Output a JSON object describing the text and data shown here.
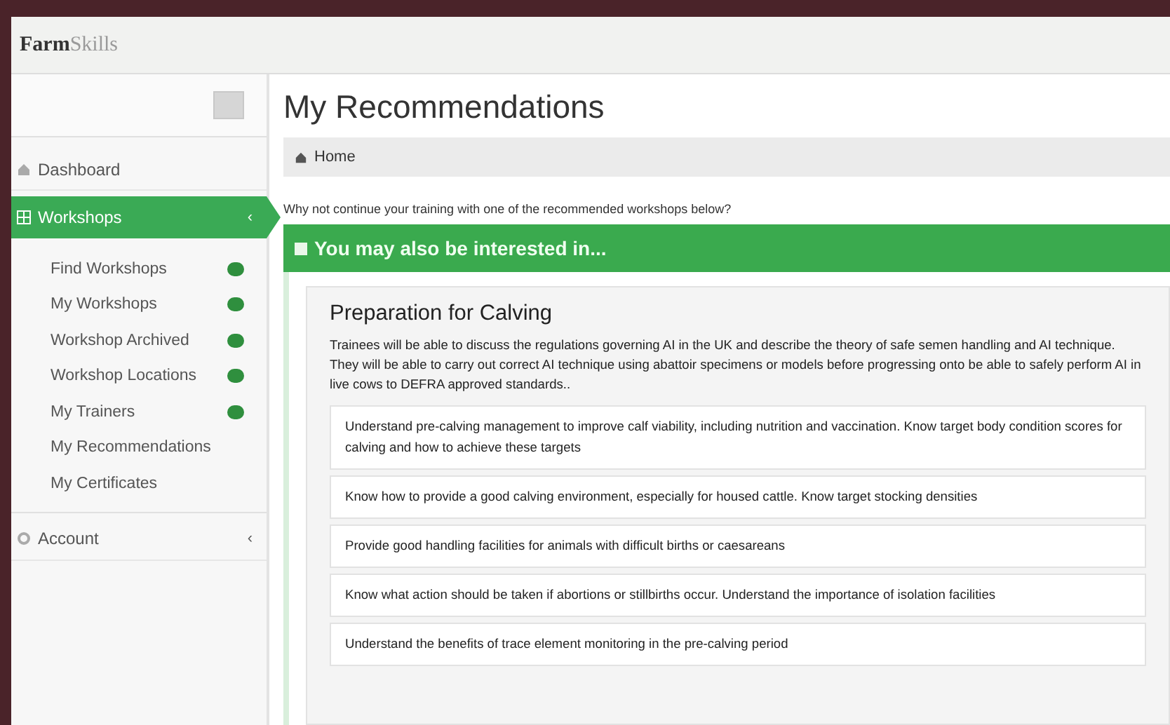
{
  "header": {
    "logo_dark": "Farm",
    "logo_light": "Skills"
  },
  "sidebar": {
    "items": [
      {
        "label": "Dashboard",
        "selected": false
      },
      {
        "label": "Workshops",
        "toggle": "‹",
        "selected": true,
        "children": [
          {
            "label": "Find Workshops",
            "badge": true
          },
          {
            "label": "My Workshops",
            "badge": true
          },
          {
            "label": "Workshop Archived",
            "badge": true
          },
          {
            "label": "Workshop Locations",
            "badge": true
          },
          {
            "label": "My Trainers",
            "badge": true
          },
          {
            "label": "My Recommendations",
            "badge": false
          },
          {
            "label": "My Certificates",
            "badge": false
          }
        ]
      },
      {
        "label": "Account",
        "toggle": "‹",
        "selected": false
      }
    ]
  },
  "page": {
    "title": "My Recommendations",
    "breadcrumb": "Home",
    "intro": "Why not continue your training with one of the recommended workshops below?"
  },
  "panel": {
    "title": "You may also be interested in...",
    "workshop": {
      "title": "Preparation for Calving",
      "description": "Trainees will be able to discuss the regulations governing AI in the UK and describe the theory of safe semen handling and AI technique. They will be able to carry out correct AI technique using abattoir specimens or models before progressing onto be able to safely perform AI in live cows to DEFRA approved standards..",
      "outcomes": [
        "Understand pre-calving management to improve calf viability, including nutrition and vaccination. Know target body condition scores for calving and how to achieve these targets",
        "Know how to provide a good calving environment, especially for housed cattle. Know target stocking densities",
        "Provide good handling facilities for animals with difficult births or caesareans",
        "Know what action should be taken if abortions or stillbirths occur. Understand the importance of isolation facilities",
        "Understand the benefits of trace element monitoring in the pre-calving period"
      ]
    }
  }
}
